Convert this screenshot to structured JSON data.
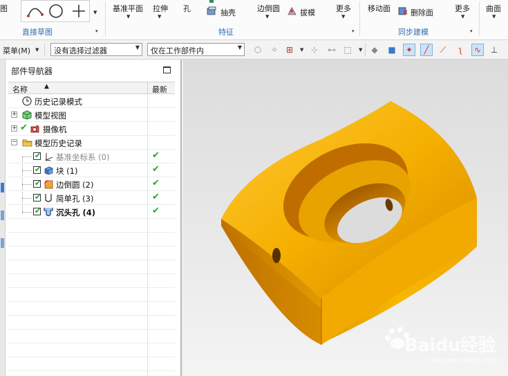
{
  "ribbon": {
    "left_cut_label": "图",
    "items": {
      "datum_plane": "基准平面",
      "extrude": "拉伸",
      "hole": "孔",
      "shell": "抽壳",
      "edge_blend": "边倒圆",
      "draft": "拔模",
      "more_feature": "更多",
      "move_face": "移动面",
      "delete_face": "删除面",
      "more_sync": "更多",
      "surface": "曲面"
    },
    "groups": {
      "direct_sketch": "直接草图",
      "feature": "特征",
      "sync_modeling": "同步建模"
    }
  },
  "toolbar": {
    "menu_label": "菜单(M)",
    "filter_value": "没有选择过滤器",
    "scope_value": "仅在工作部件内"
  },
  "navigator": {
    "title": "部件导航器",
    "columns": {
      "name": "名称",
      "latest": "最新"
    },
    "nodes": [
      {
        "label": "历史记录模式",
        "icon": "clock-icon"
      },
      {
        "label": "模型视图",
        "icon": "model-view-icon"
      },
      {
        "label": "摄像机",
        "icon": "camera-icon"
      },
      {
        "label": "模型历史记录",
        "icon": "folder-icon"
      },
      {
        "label": "基准坐标系 (0)",
        "icon": "datum-csys-icon",
        "latest": "✔"
      },
      {
        "label": "块 (1)",
        "icon": "block-icon",
        "latest": "✔"
      },
      {
        "label": "边倒圆 (2)",
        "icon": "edge-blend-icon",
        "latest": "✔"
      },
      {
        "label": "简单孔 (3)",
        "icon": "simple-hole-icon",
        "latest": "✔"
      },
      {
        "label": "沉头孔 (4)",
        "icon": "counterbore-hole-icon",
        "latest": "✔"
      }
    ]
  },
  "watermark": {
    "main": "Baidu经验",
    "sub": "jingyan.baidu.com"
  },
  "colors": {
    "model_face": "#f5b400",
    "model_shadow": "#9c5a00",
    "accent_blue": "#2f6fb3",
    "tick_green": "#1ea93c"
  }
}
